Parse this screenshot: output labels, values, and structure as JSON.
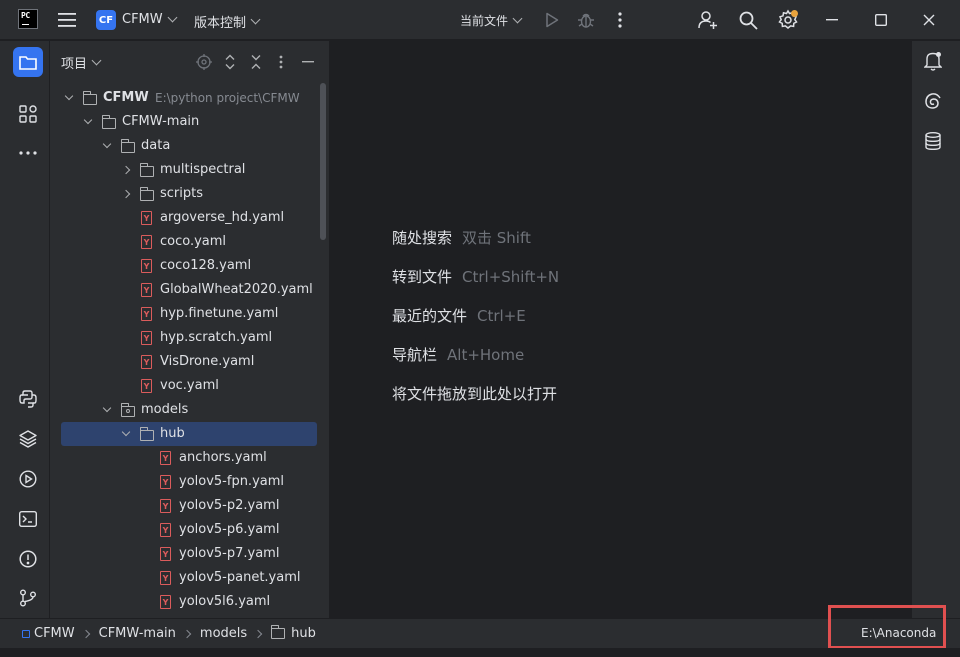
{
  "titlebar": {
    "logo_text": "PC",
    "project_badge": "CF",
    "project_name": "CFMW",
    "vcs_menu": "版本控制",
    "run_config": "当前文件"
  },
  "panel": {
    "title": "项目"
  },
  "tree": [
    {
      "label": "CFMW",
      "path": "E:\\python project\\CFMW",
      "kind": "folder",
      "arrow": "open",
      "bold": true
    },
    {
      "label": "CFMW-main",
      "kind": "folder",
      "arrow": "open"
    },
    {
      "label": "data",
      "kind": "folder",
      "arrow": "open"
    },
    {
      "label": "multispectral",
      "kind": "folder",
      "arrow": "closed"
    },
    {
      "label": "scripts",
      "kind": "folder",
      "arrow": "closed"
    },
    {
      "label": "argoverse_hd.yaml",
      "kind": "yaml"
    },
    {
      "label": "coco.yaml",
      "kind": "yaml"
    },
    {
      "label": "coco128.yaml",
      "kind": "yaml"
    },
    {
      "label": "GlobalWheat2020.yaml",
      "kind": "yaml"
    },
    {
      "label": "hyp.finetune.yaml",
      "kind": "yaml"
    },
    {
      "label": "hyp.scratch.yaml",
      "kind": "yaml"
    },
    {
      "label": "VisDrone.yaml",
      "kind": "yaml"
    },
    {
      "label": "voc.yaml",
      "kind": "yaml"
    },
    {
      "label": "models",
      "kind": "package",
      "arrow": "open"
    },
    {
      "label": "hub",
      "kind": "folder",
      "arrow": "open",
      "selected": true
    },
    {
      "label": "anchors.yaml",
      "kind": "yaml"
    },
    {
      "label": "yolov5-fpn.yaml",
      "kind": "yaml"
    },
    {
      "label": "yolov5-p2.yaml",
      "kind": "yaml"
    },
    {
      "label": "yolov5-p6.yaml",
      "kind": "yaml"
    },
    {
      "label": "yolov5-p7.yaml",
      "kind": "yaml"
    },
    {
      "label": "yolov5-panet.yaml",
      "kind": "yaml"
    },
    {
      "label": "yolov5l6.yaml",
      "kind": "yaml"
    }
  ],
  "editor_hints": [
    {
      "action": "随处搜索",
      "shortcut": "双击 Shift"
    },
    {
      "action": "转到文件",
      "shortcut": "Ctrl+Shift+N"
    },
    {
      "action": "最近的文件",
      "shortcut": "Ctrl+E"
    },
    {
      "action": "导航栏",
      "shortcut": "Alt+Home"
    },
    {
      "action": "将文件拖放到此处以打开",
      "shortcut": ""
    }
  ],
  "statusbar": {
    "breadcrumbs": [
      "CFMW",
      "CFMW-main",
      "models",
      "hub"
    ],
    "interpreter": "E:\\Anaconda"
  },
  "colors": {
    "accent": "#3574f0",
    "selection": "#2e436e",
    "yaml_icon": "#db5c5c",
    "highlight_box": "#e05050"
  }
}
